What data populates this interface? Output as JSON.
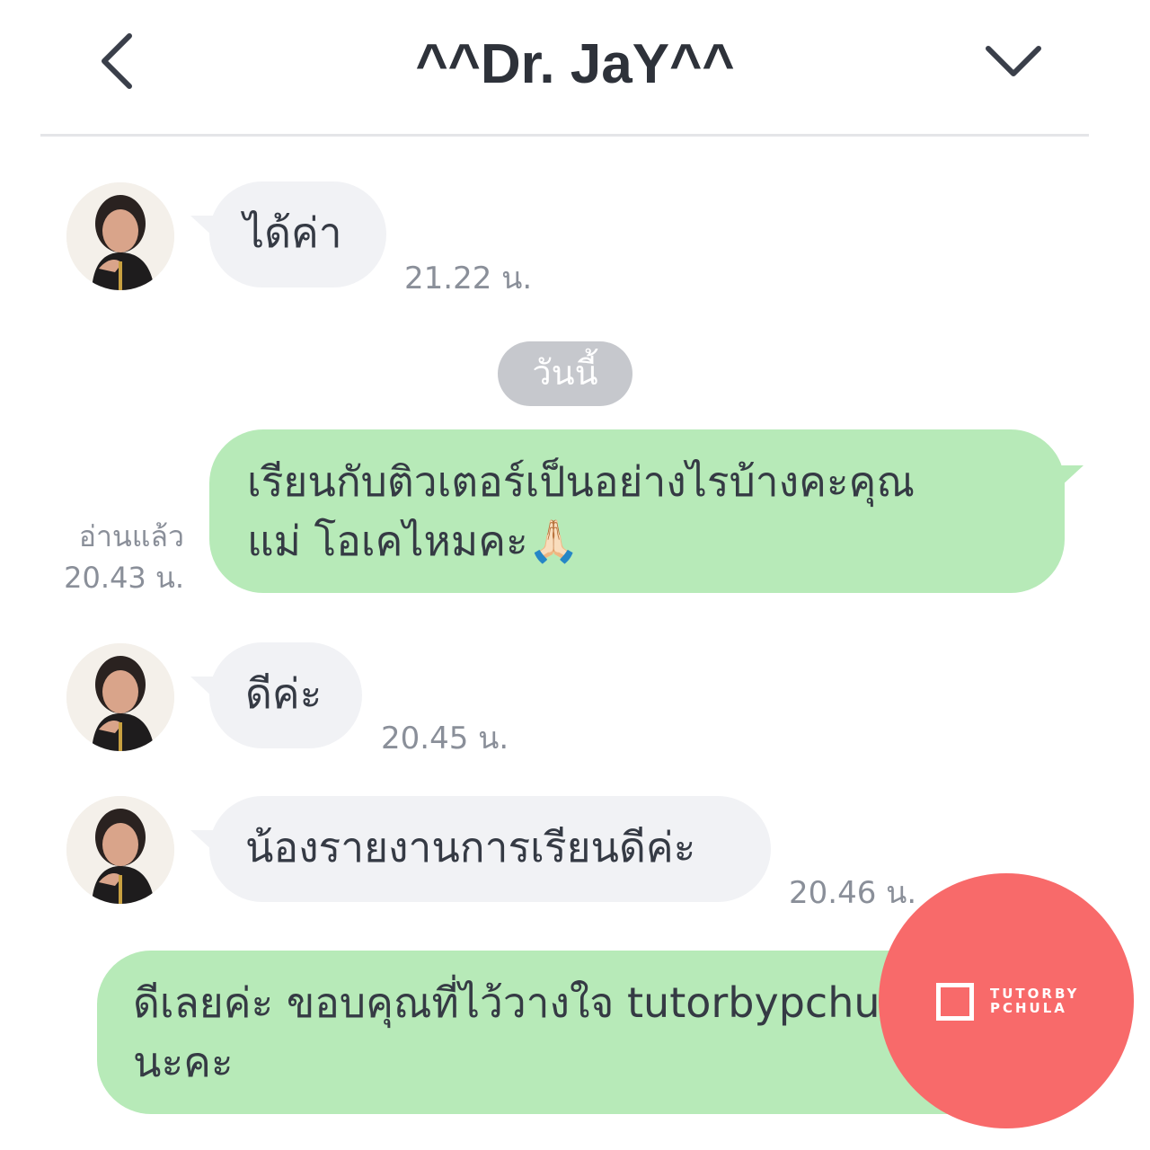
{
  "header": {
    "title": "^^Dr. JaY^^",
    "back_icon": "chevron-left-icon",
    "menu_icon": "chevron-down-icon"
  },
  "messages": [
    {
      "direction": "in",
      "text": "ได้ค่า",
      "time": "21.22 น."
    },
    {
      "direction": "separator",
      "text": "วันนี้"
    },
    {
      "direction": "out",
      "lines": [
        "เรียนกับติวเตอร์เป็นอย่างไรบ้างคะคุณ",
        "แม่ โอเคไหมคะ🙏🏻"
      ],
      "read": "อ่านแล้ว",
      "time": "20.43 น."
    },
    {
      "direction": "in",
      "text": "ดีค่ะ",
      "time": "20.45 น."
    },
    {
      "direction": "in",
      "text": "น้องรายงานการเรียนดีค่ะ",
      "time": "20.46 น."
    },
    {
      "direction": "out",
      "lines": [
        "ดีเลยค่ะ ขอบคุณที่ไว้วางใจ tutorbypchula",
        "นะคะ"
      ]
    }
  ],
  "watermark": {
    "line1": "TUTORBY",
    "line2": "PCHULA",
    "color": "#f86a6a"
  },
  "colors": {
    "incoming_bubble": "#f1f2f5",
    "outgoing_bubble": "#b7eab8",
    "date_pill": "#c6c8cd"
  }
}
